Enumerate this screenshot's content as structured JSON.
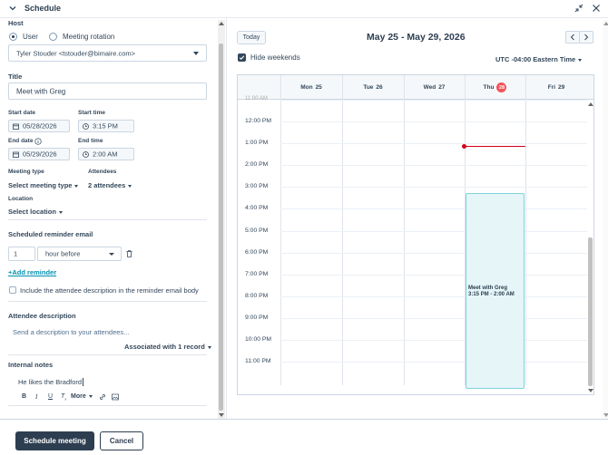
{
  "header": {
    "title": "Schedule"
  },
  "form": {
    "host_label": "Host",
    "host_options": [
      "User",
      "Meeting rotation"
    ],
    "host_value": "Tyler Stouder <tstouder@bimaire.com>",
    "title_label": "Title",
    "title_value": "Meet with Greg",
    "start_date_label": "Start date",
    "start_date": "05/28/2026",
    "start_time_label": "Start time",
    "start_time": "3:15 PM",
    "end_date_label": "End date",
    "end_date": "05/29/2026",
    "end_time_label": "End time",
    "end_time": "2:00 AM",
    "meeting_type_label": "Meeting type",
    "meeting_type_value": "Select meeting type",
    "attendees_label": "Attendees",
    "attendees_value": "2 attendees",
    "location_label": "Location",
    "location_value": "Select location",
    "reminder_label": "Scheduled reminder email",
    "reminder_count": "1",
    "reminder_unit": "hour before",
    "add_reminder": "Add reminder",
    "include_desc_label": "Include the attendee description in the reminder email body",
    "attendee_desc_label": "Attendee description",
    "attendee_desc_placeholder": "Send a description to your attendees...",
    "associated": "Associated with 1 record",
    "internal_notes_label": "Internal notes",
    "internal_notes_value": "He likes the Bradford",
    "toolbar": {
      "bold": "B",
      "italic": "I",
      "underline": "U",
      "clear": "T",
      "more": "More"
    }
  },
  "calendar": {
    "today_button": "Today",
    "range_title": "May 25 - May 29, 2026",
    "hide_weekends_label": "Hide weekends",
    "hide_weekends_checked": true,
    "timezone": "UTC -04:00 Eastern Time",
    "days": [
      {
        "name": "Mon",
        "num": "25"
      },
      {
        "name": "Tue",
        "num": "26"
      },
      {
        "name": "Wed",
        "num": "27"
      },
      {
        "name": "Thu",
        "num": "28",
        "today": true
      },
      {
        "name": "Fri",
        "num": "29"
      }
    ],
    "hours": [
      "12:00 PM",
      "1:00 PM",
      "2:00 PM",
      "3:00 PM",
      "4:00 PM",
      "5:00 PM",
      "6:00 PM",
      "7:00 PM",
      "8:00 PM",
      "9:00 PM",
      "10:00 PM",
      "11:00 PM"
    ],
    "event": {
      "title": "Meet with Greg",
      "time": "3:15 PM - 2:00 AM"
    }
  },
  "footer": {
    "primary": "Schedule meeting",
    "secondary": "Cancel"
  },
  "colors": {
    "accent": "#2d3e50",
    "now_line": "#d0021b",
    "event_bg": "#e5f5f8",
    "event_border": "#7fd1de",
    "today_badge": "#f2545b",
    "link": "#0091ae"
  }
}
